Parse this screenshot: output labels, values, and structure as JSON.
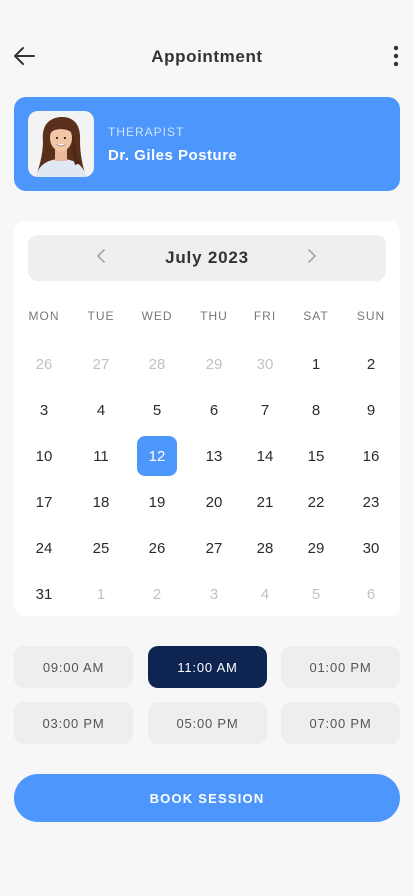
{
  "header": {
    "title": "Appointment",
    "back_icon": "arrow-left-icon",
    "more_icon": "vertical-dots-icon"
  },
  "therapist": {
    "role": "THERAPIST",
    "name": "Dr. Giles Posture",
    "avatar_icon": "therapist-photo"
  },
  "calendar": {
    "month_label": "July 2023",
    "prev_icon": "chevron-left-icon",
    "next_icon": "chevron-right-icon",
    "weekdays": [
      "MON",
      "TUE",
      "WED",
      "THU",
      "FRI",
      "SAT",
      "SUN"
    ],
    "weeks": [
      [
        "26",
        "27",
        "28",
        "29",
        "30",
        "1",
        "2"
      ],
      [
        "3",
        "4",
        "5",
        "6",
        "7",
        "8",
        "9"
      ],
      [
        "10",
        "11",
        "12",
        "13",
        "14",
        "15",
        "16"
      ],
      [
        "17",
        "18",
        "19",
        "20",
        "21",
        "22",
        "23"
      ],
      [
        "24",
        "25",
        "26",
        "27",
        "28",
        "29",
        "30"
      ],
      [
        "31",
        "1",
        "2",
        "3",
        "4",
        "5",
        "6"
      ]
    ],
    "selected_day": "12"
  },
  "time_slots": {
    "slots": [
      "09:00 AM",
      "11:00 AM",
      "01:00 PM",
      "03:00 PM",
      "05:00 PM",
      "07:00 PM"
    ],
    "selected": "11:00 AM"
  },
  "book_button": {
    "label": "BOOK SESSION"
  },
  "colors": {
    "accent": "#4d96fb",
    "selected_slot": "#0e2552",
    "background": "#f7f7f8"
  }
}
